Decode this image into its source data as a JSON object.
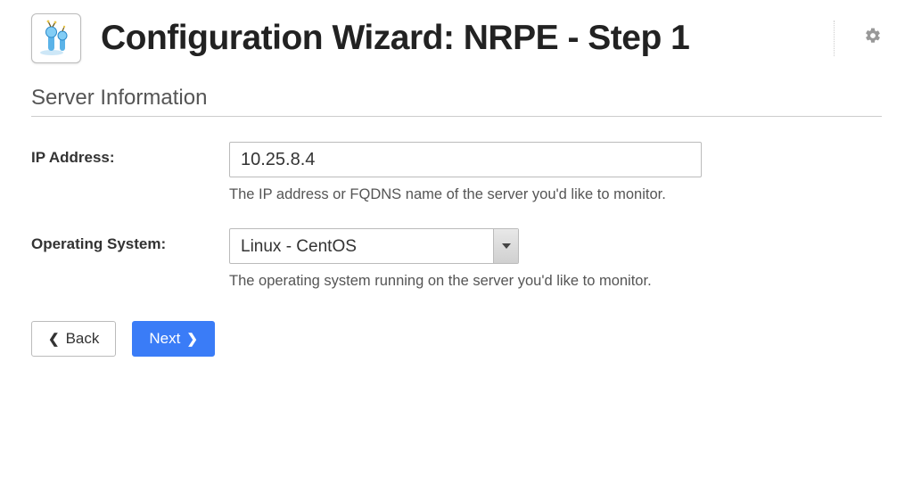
{
  "header": {
    "title": "Configuration Wizard: NRPE - Step 1"
  },
  "section": {
    "title": "Server Information"
  },
  "form": {
    "ip": {
      "label": "IP Address:",
      "value": "10.25.8.4",
      "help": "The IP address or FQDNS name of the server you'd like to monitor."
    },
    "os": {
      "label": "Operating System:",
      "value": "Linux - CentOS",
      "help": "The operating system running on the server you'd like to monitor."
    }
  },
  "buttons": {
    "back": "Back",
    "next": "Next"
  }
}
